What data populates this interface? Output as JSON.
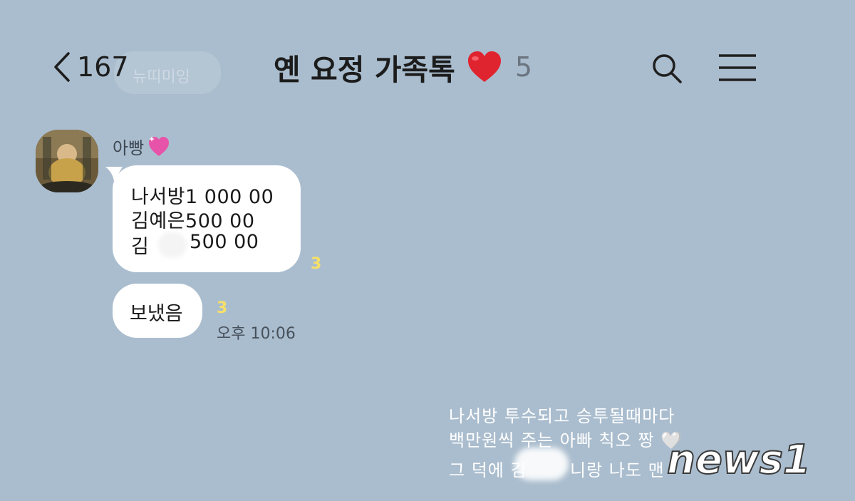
{
  "header": {
    "back_count": "167",
    "title": "옌 요정 가족톡",
    "member_count": "5"
  },
  "background_ghost": {
    "text": "뉴띠미잉"
  },
  "messages": {
    "sender_name": "아빵",
    "bubble1_lines": [
      "나서방1 000 00",
      "김예은500 00",
      "김",
      "500 00"
    ],
    "bubble1_unread": "3",
    "bubble2_text": "보냈음",
    "bubble2_unread": "3",
    "time": "오후 10:06"
  },
  "caption": {
    "line1": "나서방 투수되고 승투될때마다",
    "line2": "백만원씩 주는 아빠 칙오 짱 🤍",
    "line3_a": "그 덕에 김",
    "line3_b": "니랑 나도 맨"
  },
  "watermark": {
    "text": "news1"
  },
  "colors": {
    "chat_background": "#aabdce",
    "bubble": "#ffffff",
    "unread": "#f6e06a",
    "heart": "#e0242f",
    "sender_heart": "#e653a8"
  }
}
